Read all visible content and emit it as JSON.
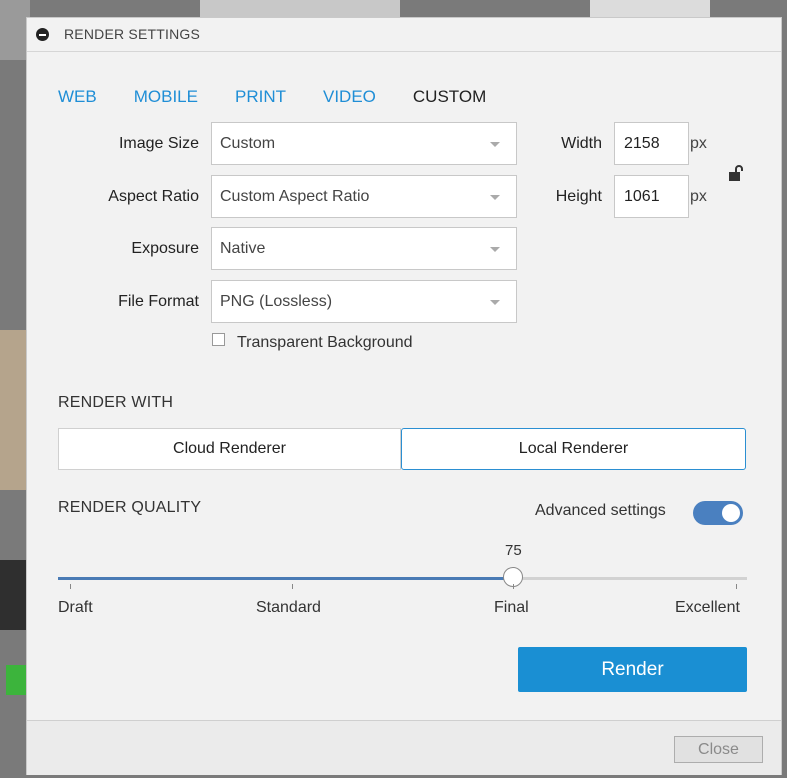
{
  "window": {
    "title": "RENDER SETTINGS"
  },
  "tabs": [
    {
      "label": "WEB",
      "active": false
    },
    {
      "label": "MOBILE",
      "active": false
    },
    {
      "label": "PRINT",
      "active": false
    },
    {
      "label": "VIDEO",
      "active": false
    },
    {
      "label": "CUSTOM",
      "active": true
    }
  ],
  "fields": {
    "image_size": {
      "label": "Image Size",
      "value": "Custom"
    },
    "aspect_ratio": {
      "label": "Aspect Ratio",
      "value": "Custom Aspect Ratio"
    },
    "exposure": {
      "label": "Exposure",
      "value": "Native"
    },
    "file_format": {
      "label": "File Format",
      "value": "PNG (Lossless)"
    },
    "width": {
      "label": "Width",
      "value": "2158",
      "unit": "px"
    },
    "height": {
      "label": "Height",
      "value": "1061",
      "unit": "px"
    },
    "transparent_background": {
      "label": "Transparent Background",
      "checked": false
    }
  },
  "render_with": {
    "title": "RENDER WITH",
    "options": [
      "Cloud Renderer",
      "Local Renderer"
    ],
    "selected": "Local Renderer"
  },
  "render_quality": {
    "title": "RENDER QUALITY",
    "advanced_label": "Advanced settings",
    "advanced_enabled": true,
    "value": "75",
    "value_fraction": 0.66,
    "ticks": [
      "Draft",
      "Standard",
      "Final",
      "Excellent"
    ]
  },
  "buttons": {
    "render": "Render",
    "close": "Close"
  },
  "icons": {
    "collapse": "minus-circle-icon",
    "lock": "unlock-icon",
    "caret": "chevron-down-icon"
  },
  "colors": {
    "accent": "#1a8fd3",
    "tab_link": "#1f8ed6",
    "toggle": "#4a80c0",
    "slider_fill": "#4a7bb5"
  }
}
